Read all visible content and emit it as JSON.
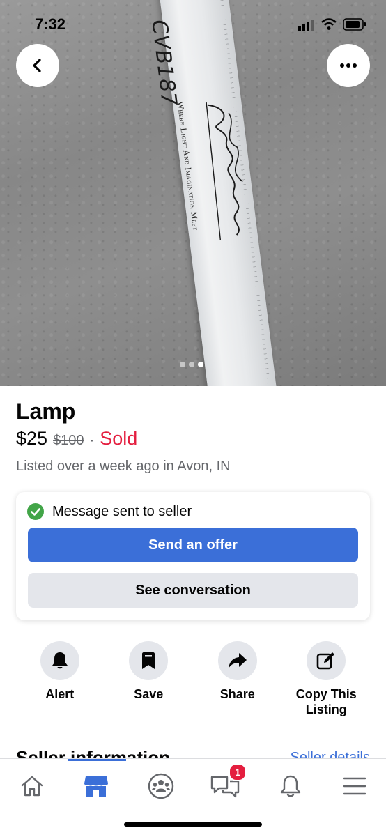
{
  "status_bar": {
    "time": "7:32"
  },
  "photo": {
    "box_code": "CVB187",
    "box_tagline": "Where Light And Imagination Meet",
    "signature_text": "Roland Simmons",
    "page_count": 3,
    "active_page_index": 2
  },
  "listing": {
    "title": "Lamp",
    "price": "$25",
    "original_price": "$100",
    "separator": "·",
    "status": "Sold",
    "listed_text": "Listed over a week ago in Avon, IN"
  },
  "message_card": {
    "message_status": "Message sent to seller",
    "primary_button": "Send an offer",
    "secondary_button": "See conversation"
  },
  "actions": [
    {
      "label": "Alert",
      "icon": "bell-icon"
    },
    {
      "label": "Save",
      "icon": "bookmark-icon"
    },
    {
      "label": "Share",
      "icon": "share-arrow-icon"
    },
    {
      "label": "Copy This Listing",
      "icon": "edit-icon"
    }
  ],
  "seller": {
    "heading": "Seller information",
    "details_link": "Seller details"
  },
  "bottom_nav": {
    "items": [
      "home-icon",
      "marketplace-icon",
      "groups-icon",
      "messenger-icon",
      "notifications-icon",
      "menu-icon"
    ],
    "active": "marketplace-icon",
    "messenger_badge": "1"
  },
  "colors": {
    "accent": "#3b6fd8",
    "sold": "#e41e3f",
    "success": "#42a548",
    "button_gray": "#e4e6eb"
  }
}
